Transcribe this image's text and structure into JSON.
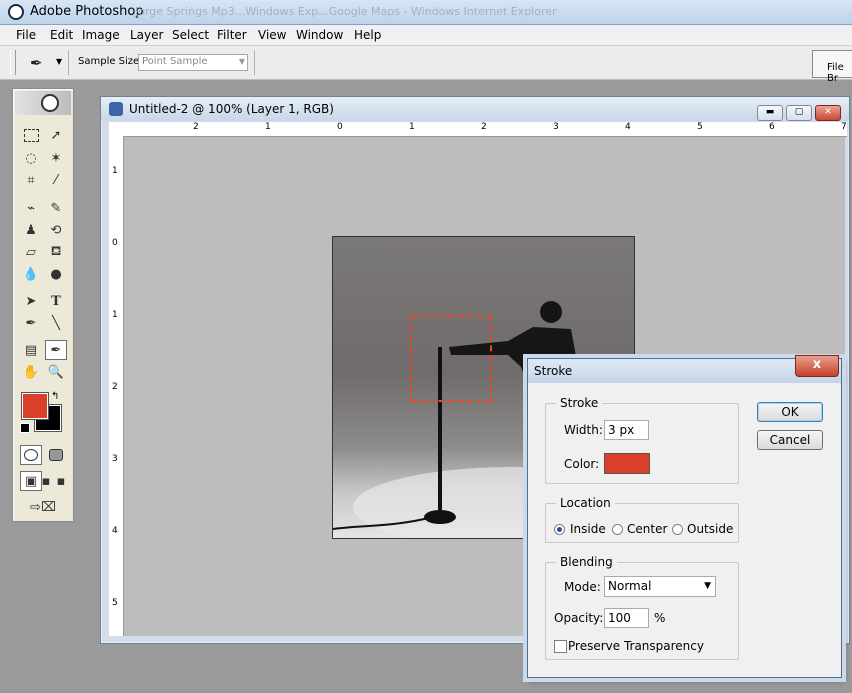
{
  "app": {
    "title": "Adobe Photoshop",
    "ghost_tabs": "Jorge Springs Mp3...Windows Exp...Google Maps - Windows Internet Explorer"
  },
  "menu": [
    "File",
    "Edit",
    "Image",
    "Layer",
    "Select",
    "Filter",
    "View",
    "Window",
    "Help"
  ],
  "options": {
    "tool_icon": "eyedropper-icon",
    "sample_size_label": "Sample Size:",
    "sample_size_value": "Point Sample",
    "file_browser_label": "File Br"
  },
  "document": {
    "title": "Untitled-2 @ 100% (Layer 1, RGB)",
    "ruler_top": [
      "2",
      "1",
      "0",
      "1",
      "2",
      "3",
      "4",
      "5",
      "6",
      "7"
    ],
    "ruler_left": [
      "1",
      "0",
      "1",
      "2",
      "3",
      "4",
      "5"
    ]
  },
  "colors": {
    "foreground": "#d9402a",
    "background": "#000000",
    "stroke": "#d9402a"
  },
  "dialog": {
    "title": "Stroke",
    "close": "x",
    "stroke_group": "Stroke",
    "width_label": "Width:",
    "width_value": "3 px",
    "color_label": "Color:",
    "location_group": "Location",
    "location_options": [
      "Inside",
      "Center",
      "Outside"
    ],
    "location_selected": "Inside",
    "blending_group": "Blending",
    "mode_label": "Mode:",
    "mode_value": "Normal",
    "opacity_label": "Opacity:",
    "opacity_value": "100",
    "opacity_unit": "%",
    "preserve_label": "Preserve Transparency",
    "ok": "OK",
    "cancel": "Cancel"
  }
}
